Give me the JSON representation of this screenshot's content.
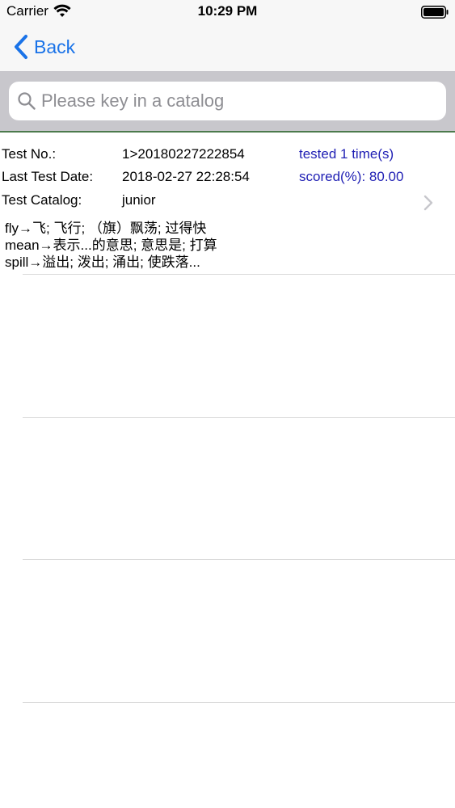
{
  "status_bar": {
    "carrier": "Carrier",
    "time": "10:29 PM"
  },
  "nav": {
    "back_label": "Back"
  },
  "search": {
    "placeholder": "Please key in a catalog",
    "value": ""
  },
  "test_record": {
    "test_no_label": "Test No.:",
    "test_no_value": "1>20180227222854",
    "tested_text": "tested 1 time(s)",
    "last_date_label": "Last Test Date:",
    "last_date_value": "2018-02-27 22:28:54",
    "scored_text": "scored(%): 80.00",
    "catalog_label": "Test Catalog:",
    "catalog_value": "junior",
    "words": [
      "fly→飞; 飞行; （旗）飘荡; 过得快",
      "mean→表示...的意思; 意思是; 打算",
      "spill→溢出; 泼出; 涌出; 使跌落..."
    ]
  },
  "colors": {
    "accent": "#1a73e8",
    "stat_text": "#1f1fb4",
    "search_bar_bg": "#c8c7cc"
  }
}
